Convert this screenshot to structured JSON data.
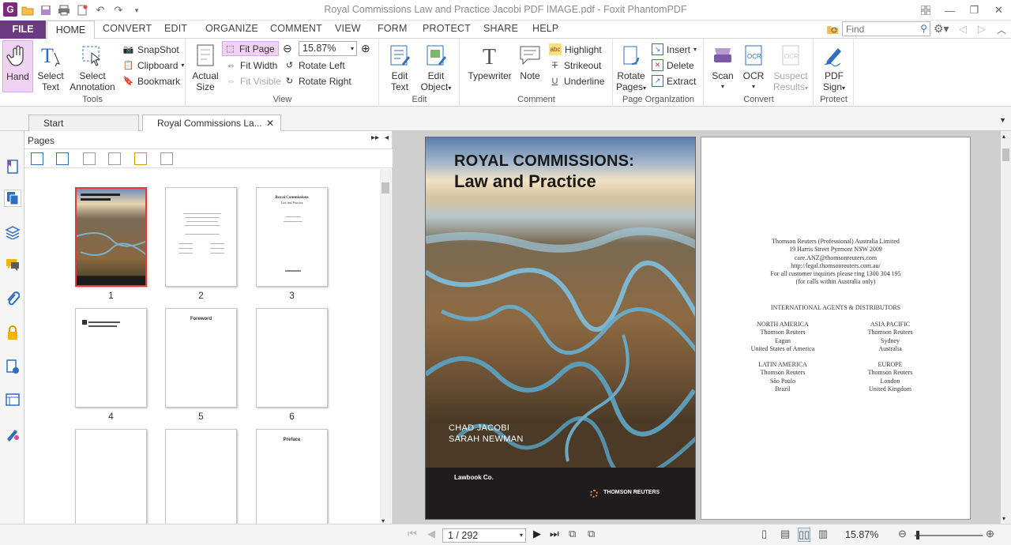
{
  "window": {
    "title": "Royal Commissions Law and Practice Jacobi PDF IMAGE.pdf - Foxit PhantomPDF",
    "app_logo": "G"
  },
  "menu": {
    "file": "FILE",
    "tabs": [
      "HOME",
      "CONVERT",
      "EDIT",
      "ORGANIZE",
      "COMMENT",
      "VIEW",
      "FORM",
      "PROTECT",
      "SHARE",
      "HELP"
    ],
    "search_placeholder": "Find"
  },
  "ribbon": {
    "tools": {
      "label": "Tools",
      "hand": "Hand",
      "select_text_1": "Select",
      "select_text_2": "Text",
      "select_ann_1": "Select",
      "select_ann_2": "Annotation",
      "snapshot": "SnapShot",
      "clipboard": "Clipboard",
      "bookmark": "Bookmark"
    },
    "view": {
      "label": "View",
      "actual_1": "Actual",
      "actual_2": "Size",
      "fit_page": "Fit Page",
      "fit_width": "Fit Width",
      "fit_visible": "Fit Visible",
      "zoom_value": "15.87%",
      "rotate_left": "Rotate Left",
      "rotate_right": "Rotate Right"
    },
    "edit": {
      "label": "Edit",
      "edit_text_1": "Edit",
      "edit_text_2": "Text",
      "edit_obj_1": "Edit",
      "edit_obj_2": "Object"
    },
    "comment": {
      "label": "Comment",
      "typewriter": "Typewriter",
      "note": "Note",
      "highlight": "Highlight",
      "strikeout": "Strikeout",
      "underline": "Underline"
    },
    "organize": {
      "label": "Page Organization",
      "rotate_1": "Rotate",
      "rotate_2": "Pages",
      "insert": "Insert",
      "delete": "Delete",
      "extract": "Extract"
    },
    "convert": {
      "label": "Convert",
      "scan": "Scan",
      "ocr": "OCR",
      "suspect_1": "Suspect",
      "suspect_2": "Results"
    },
    "protect": {
      "label": "Protect",
      "pdf_sign_1": "PDF",
      "pdf_sign_2": "Sign"
    }
  },
  "doc_tabs": {
    "start": "Start",
    "current": "Royal Commissions La..."
  },
  "pages_panel": {
    "title": "Pages",
    "thumbnails": [
      "1",
      "2",
      "3",
      "4",
      "5",
      "6",
      "",
      "",
      ""
    ],
    "thumb5_heading": "Foreword",
    "thumb9_heading": "Preface",
    "thumb3_title": "Royal Commissions",
    "thumb3_sub": "Law and Practice"
  },
  "cover": {
    "title_line1": "ROYAL COMMISSIONS:",
    "title_line2": "Law and Practice",
    "author1": "CHAD JACOBI",
    "author2": "SARAH NEWMAN",
    "publisher": "Lawbook Co.",
    "brand": "THOMSON REUTERS"
  },
  "page2": {
    "lines": [
      "Thomson Reuters (Professional) Australia Limited",
      "19 Harris Street Pyrmont NSW 2009",
      "care.ANZ@thomsonreuters.com",
      "http://legal.thomsonreuters.com.au/",
      "For all customer inquiries please ring 1300 304 195",
      "(for calls within Australia only)"
    ],
    "agents_heading": "INTERNATIONAL AGENTS & DISTRIBUTORS",
    "regions": [
      {
        "name": "NORTH AMERICA",
        "l1": "Thomson Reuters",
        "l2": "Eagan",
        "l3": "United States of America"
      },
      {
        "name": "ASIA PACIFIC",
        "l1": "Thomson Reuters",
        "l2": "Sydney",
        "l3": "Australia"
      },
      {
        "name": "LATIN AMERICA",
        "l1": "Thomson Reuters",
        "l2": "São Paulo",
        "l3": "Brazil"
      },
      {
        "name": "EUROPE",
        "l1": "Thomson Reuters",
        "l2": "London",
        "l3": "United Kingdom"
      }
    ]
  },
  "status": {
    "page": "1 / 292",
    "zoom": "15.87%"
  },
  "colors": {
    "brand": "#6a3a83",
    "selection": "#e03a3a",
    "highlight_bg": "#f0d2f2"
  }
}
